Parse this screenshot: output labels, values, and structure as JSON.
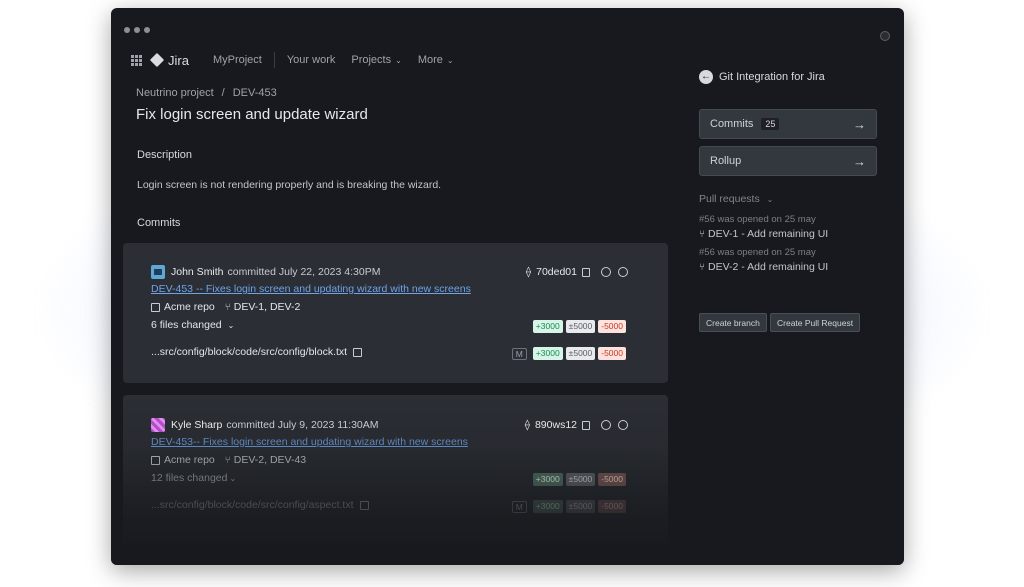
{
  "nav": {
    "product": "Jira",
    "items": [
      "MyProject",
      "Your work",
      "Projects",
      "More"
    ]
  },
  "breadcrumb": {
    "project": "Neutrino project",
    "separator": "/",
    "issue": "DEV-453"
  },
  "issue": {
    "title": "Fix login screen and update wizard",
    "description_heading": "Description",
    "description": "Login screen is not rendering properly and is breaking the wizard.",
    "commits_heading": "Commits"
  },
  "commits": [
    {
      "author": "John Smith",
      "committed": "committed July 22, 2023 4:30PM",
      "hash": "70ded01",
      "message": "DEV-453 -- Fixes login screen and updating wizard with new screens",
      "repo": "Acme repo",
      "branches": "DEV-1, DEV-2",
      "files_changed": "6 files changed",
      "summary": {
        "added": "+3000",
        "modified": "±5000",
        "deleted": "-5000"
      },
      "file": {
        "path": "...src/config/block/code/src/config/block.txt",
        "status": "M",
        "added": "+3000",
        "modified": "±5000",
        "deleted": "-5000"
      }
    },
    {
      "author": "Kyle Sharp",
      "committed": "committed July 9, 2023 11:30AM",
      "hash": "890ws12",
      "message": "DEV-453-- Fixes login screen and updating wizard with new screens",
      "repo": "Acme repo",
      "branches": "DEV-2, DEV-43",
      "files_changed": "12 files changed",
      "summary": {
        "added": "+3000",
        "modified": "±5000",
        "deleted": "-5000"
      },
      "file": {
        "path": "...src/config/block/code/src/config/aspect.txt",
        "status": "M",
        "added": "+3000",
        "modified": "±5000",
        "deleted": "-5000"
      }
    }
  ],
  "panel": {
    "title": "Git Integration for Jira",
    "commits_label": "Commits",
    "commits_count": "25",
    "rollup_label": "Rollup",
    "pull_requests_label": "Pull requests",
    "pull_requests": [
      {
        "opened": "#56 was opened on 25 may",
        "title": "DEV-1 - Add remaining UI"
      },
      {
        "opened": "#56 was opened on 25 may",
        "title": "DEV-2 - Add remaining UI"
      }
    ],
    "create_branch": "Create branch",
    "create_pr": "Create Pull Request"
  }
}
